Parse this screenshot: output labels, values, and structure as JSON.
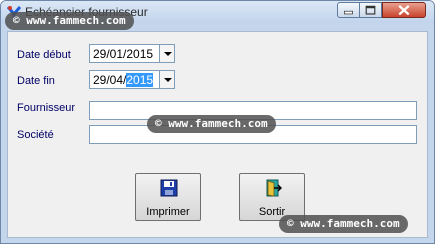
{
  "window": {
    "title": "Echéancier fournisseur"
  },
  "form": {
    "date_debut": {
      "label": "Date début",
      "value_main": "29/01/2015",
      "value_selected": ""
    },
    "date_fin": {
      "label": "Date fin",
      "value_main": "29/04/",
      "value_selected": "2015"
    },
    "fournisseur": {
      "label": "Fournisseur",
      "value": ""
    },
    "societe": {
      "label": "Société",
      "value": ""
    }
  },
  "buttons": {
    "imprimer": {
      "label": "Imprimer",
      "icon": "floppy-disk-icon"
    },
    "sortir": {
      "label": "Sortir",
      "icon": "exit-door-icon"
    }
  },
  "watermark": {
    "text": "© www.fammech.com"
  },
  "colors": {
    "label_color": "#000066",
    "selection": "#3399ff",
    "titlebar": "#c4d6ec"
  }
}
